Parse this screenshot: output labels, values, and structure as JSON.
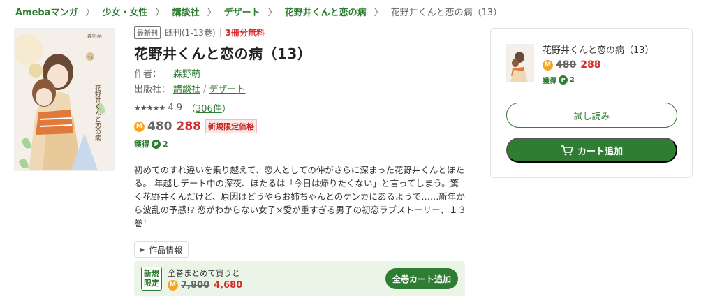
{
  "breadcrumb": {
    "items": [
      "Amebaマンガ",
      "少女・女性",
      "講談社",
      "デザート",
      "花野井くんと恋の病"
    ],
    "current": "花野井くんと恋の病（13）",
    "separator": "〉"
  },
  "book": {
    "badge_new": "最新刊",
    "volume_range": "既刊(1-13巻)",
    "volume_sep": "|",
    "free_text": "3冊分無料",
    "title": "花野井くんと恋の病（13）",
    "author_label": "作者：",
    "author": "森野萌",
    "publisher_label": "出版社：",
    "publisher": "講談社",
    "publisher_sep": "/",
    "label": "デザート",
    "stars": "★★★★★",
    "rating": "4.9",
    "rating_count_open": "（",
    "rating_count": "306件",
    "rating_count_close": "）",
    "coin_symbol": "M",
    "old_price": "480",
    "new_price": "288",
    "limited_badge": "新規限定価格",
    "points_label": "獲得",
    "points_icon": "P",
    "points": "2",
    "description": "初めてのすれ違いを乗り越えて、恋人としての仲がさらに深まった花野井くんとほたる。 年越しデート中の深夜、ほたるは「今日は帰りたくない」と言ってしまう。驚く花野井くんだけど、原因はどうやらお姉ちゃんとのケンカにあるようで……新年から波乱の予感!? 恋がわからない女子×愛が重すぎる男子の初恋ラブストーリー、１３巻！",
    "work_info_button": "作品情報",
    "cover_text_top": "森野萌",
    "cover_text_title": "花野井くんと恋の病",
    "cover_vol": "13"
  },
  "bulk": {
    "tag": "新規\n限定",
    "tag_line1": "新規",
    "tag_line2": "限定",
    "label": "全巻まとめて買うと",
    "old_price": "7,800",
    "new_price": "4,680",
    "button": "全巻カート追加"
  },
  "panel": {
    "title": "花野井くんと恋の病（13）",
    "old_price": "480",
    "new_price": "288",
    "points_label": "獲得",
    "points": "2",
    "trial_button": "試し読み",
    "cart_button": "カート追加"
  },
  "colors": {
    "brand_green": "#2e7d32",
    "price_red": "#d62d2d",
    "coin_orange": "#f5a623"
  }
}
